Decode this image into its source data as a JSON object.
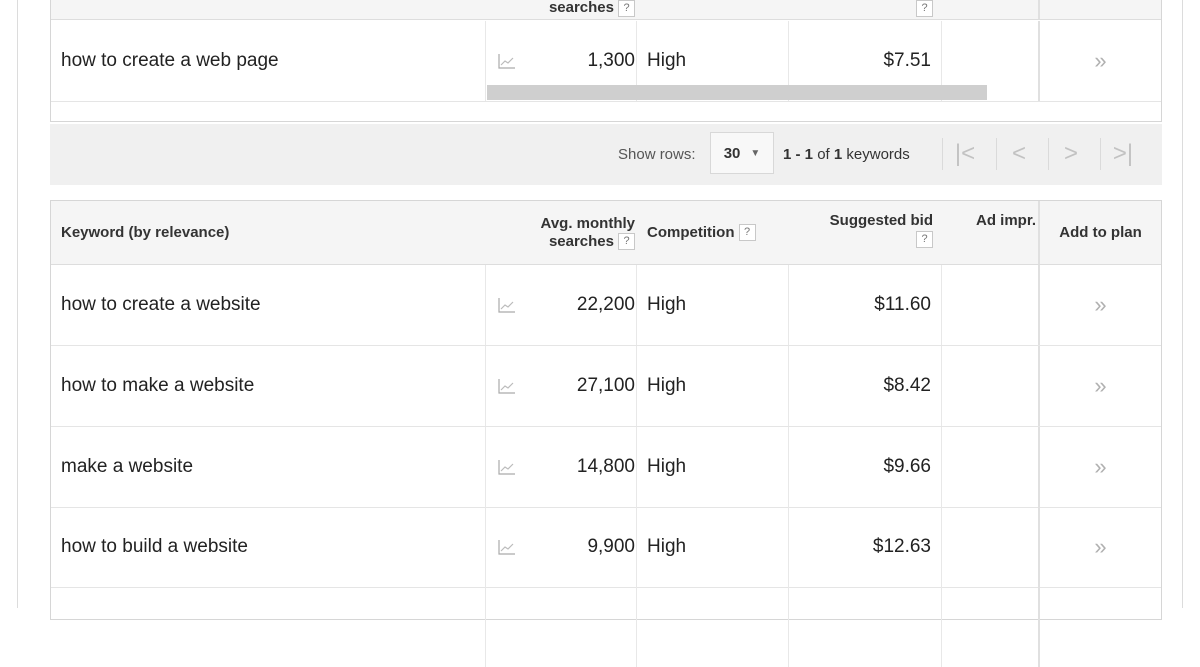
{
  "top_table": {
    "header_partial": "searches",
    "row": {
      "keyword": "how to create a web page",
      "volume": "1,300",
      "competition": "High",
      "bid": "$7.51",
      "add": "»"
    }
  },
  "pager": {
    "show_rows_label": "Show rows:",
    "rows_value": "30",
    "range_a": "1 - 1",
    "range_of": "of",
    "range_total": "1",
    "range_suffix": "keywords",
    "first": "|<",
    "prev": "<",
    "next": ">",
    "last": ">|"
  },
  "bottom_table": {
    "headers": {
      "keyword": "Keyword (by relevance)",
      "volume_line1": "Avg. monthly",
      "volume_line2": "searches",
      "competition": "Competition",
      "bid": "Suggested bid",
      "ad_impr": "Ad impr.",
      "add": "Add to plan",
      "help": "?"
    },
    "rows": [
      {
        "keyword": "how to create a website",
        "volume": "22,200",
        "competition": "High",
        "bid": "$11.60",
        "add": "»"
      },
      {
        "keyword": "how to make a website",
        "volume": "27,100",
        "competition": "High",
        "bid": "$8.42",
        "add": "»"
      },
      {
        "keyword": "make a website",
        "volume": "14,800",
        "competition": "High",
        "bid": "$9.66",
        "add": "»"
      },
      {
        "keyword": "how to build a website",
        "volume": "9,900",
        "competition": "High",
        "bid": "$12.63",
        "add": "»"
      }
    ]
  },
  "icons": {
    "trend": "line-chart-icon"
  },
  "colors": {
    "header_bg": "#f5f5f5",
    "pager_bg": "#f0f0f0",
    "scrollbar": "#cfcfcf"
  }
}
